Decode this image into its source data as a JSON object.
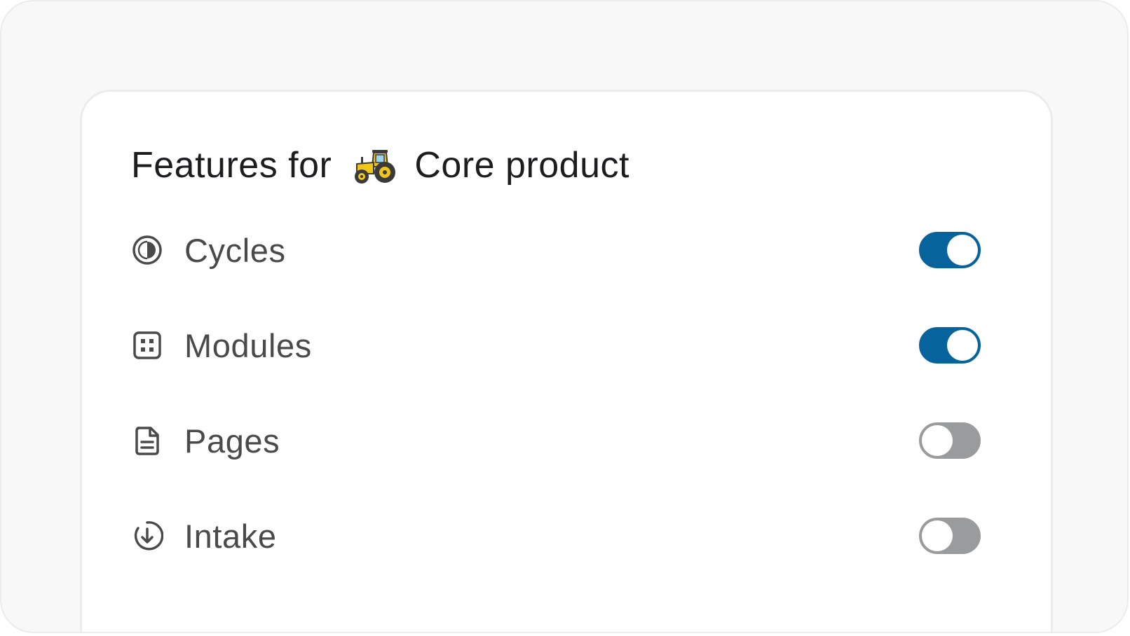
{
  "heading": {
    "prefix": "Features for",
    "project_icon": "tractor-icon",
    "project_name": "Core product"
  },
  "features": [
    {
      "label": "Cycles",
      "icon": "contrast-circle-icon",
      "enabled": true
    },
    {
      "label": "Modules",
      "icon": "grid-square-icon",
      "enabled": true
    },
    {
      "label": "Pages",
      "icon": "document-icon",
      "enabled": false
    },
    {
      "label": "Intake",
      "icon": "arrow-down-circle-icon",
      "enabled": false
    }
  ],
  "colors": {
    "toggle_on": "#07639c",
    "toggle_off": "#9a9b9d",
    "tractor_yellow": "#f2c618"
  }
}
